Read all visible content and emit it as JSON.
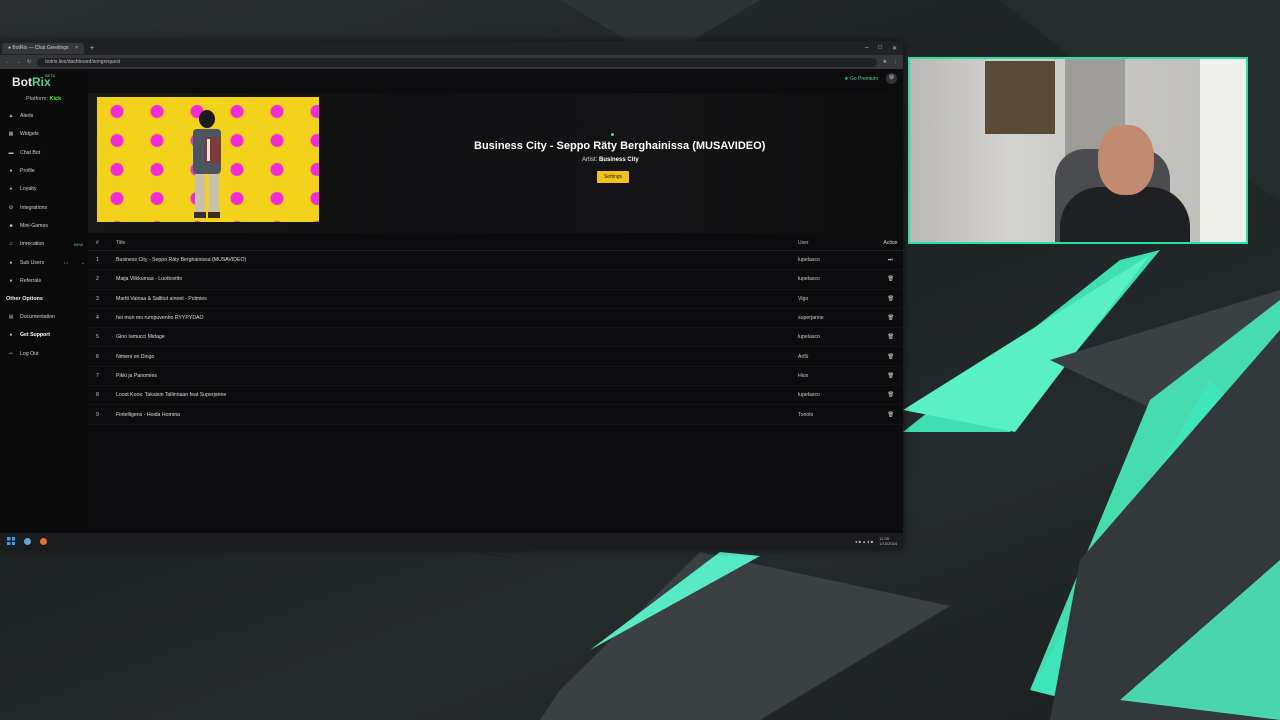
{
  "browser": {
    "tab_title": "● BotRix — Chat Greetings",
    "tab_close": "×",
    "new_tab": "+",
    "url": "botrix.live/dashboard/songrequest"
  },
  "app": {
    "logo_bot": "Bot",
    "logo_rix": "Rix",
    "beta": "BETA",
    "platform_label": "Platform:",
    "platform_value": "Kick",
    "go_premium": "Go Premium"
  },
  "sidebar": {
    "items": [
      {
        "label": "Alerts",
        "icon": "bell-icon"
      },
      {
        "label": "Widgets",
        "icon": "widgets-icon"
      },
      {
        "label": "Chat Bot",
        "icon": "chat-icon"
      },
      {
        "label": "Profile",
        "icon": "user-icon"
      },
      {
        "label": "Loyalty",
        "icon": "loyalty-icon"
      },
      {
        "label": "Integrations",
        "icon": "integrations-icon"
      },
      {
        "label": "Mini-Games",
        "icon": "games-icon"
      },
      {
        "label": "Imrecation",
        "icon": "music-icon",
        "badge": "NEW"
      },
      {
        "label": "Sub Users",
        "icon": "users-icon"
      },
      {
        "label": "Referrals",
        "icon": "referrals-icon"
      }
    ],
    "other_title": "Other Options",
    "other": [
      {
        "label": "Documentation",
        "icon": "doc-icon"
      },
      {
        "label": "Get Support",
        "icon": "support-icon"
      },
      {
        "label": "Log Out",
        "icon": "logout-icon"
      }
    ]
  },
  "now_playing": {
    "title": "Business City - Seppo Räty Berghainissa (MUSAVIDEO)",
    "artist_label": "Artist:",
    "artist": "Business City",
    "settings_button": "Settings"
  },
  "queue": {
    "headers": {
      "num": "#",
      "title": "Title",
      "user": "User",
      "action": "Action"
    },
    "rows": [
      {
        "num": "1",
        "title": "Business City - Seppo Räty Berghainissa (MUSAVIDEO)",
        "user": "lupelasco",
        "action": "⏭"
      },
      {
        "num": "2",
        "title": "Maija Vilkkumaa - Luottovitto",
        "user": "lupelasco",
        "action": "🗑"
      },
      {
        "num": "3",
        "title": "Martti Vainaa & Sallitut aineet - Polmies",
        "user": "Vigo",
        "action": "🗑"
      },
      {
        "num": "4",
        "title": "hei mun mo rumpuvenho RYYPYDAO",
        "user": "superjanne",
        "action": "🗑"
      },
      {
        "num": "5",
        "title": "Gino Iamucci Midage",
        "user": "lupelasco",
        "action": "🗑"
      },
      {
        "num": "6",
        "title": "Nimeni on Dingo",
        "user": "Ari5i",
        "action": "🗑"
      },
      {
        "num": "7",
        "title": "Pikki ja Panomies",
        "user": "Hiox",
        "action": "🗑"
      },
      {
        "num": "8",
        "title": "Loost Koos: Takaisin Tallinnaan feat Superjanne",
        "user": "lupelasco",
        "action": "🗑"
      },
      {
        "num": "9",
        "title": "Fintelligens - Hoida Homma",
        "user": "Tonolo",
        "action": "🗑"
      }
    ]
  },
  "taskbar": {
    "time": "11:39",
    "date": "1/15/2024"
  },
  "colors": {
    "accent": "#53d38d",
    "kick": "#53fc18",
    "settings": "#f2c21b",
    "cam_border": "#29e0a8"
  }
}
